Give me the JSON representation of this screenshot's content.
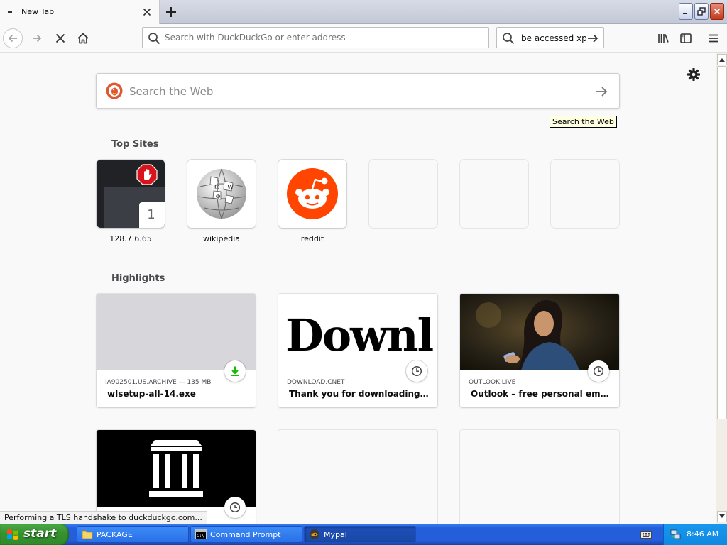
{
  "browser": {
    "tab_title": "New Tab",
    "urlbar_placeholder": "Search with DuckDuckGo or enter address",
    "searchbar_text": "be accessed xp"
  },
  "newtab": {
    "web_search_placeholder": "Search the Web",
    "tooltip": "Search the Web",
    "top_sites_title": "Top Sites",
    "top_sites": [
      {
        "label": "128.7.6.65",
        "pin_number": "1"
      },
      {
        "label": "wikipedia"
      },
      {
        "label": "reddit"
      }
    ],
    "highlights_title": "Highlights",
    "highlights": [
      {
        "context": "IA902501.US.ARCHIVE — 135 MB",
        "title": "wlsetup-all-14.exe"
      },
      {
        "context": "DOWNLOAD.CNET",
        "title": "Thank you for downloading Win...",
        "image_text": "Downl"
      },
      {
        "context": "OUTLOOK.LIVE",
        "title": "Outlook – free personal email an..."
      }
    ]
  },
  "status_text": "Performing a TLS handshake to duckduckgo.com...",
  "taskbar": {
    "start_label": "start",
    "items": [
      {
        "label": "PACKAGE"
      },
      {
        "label": "Command Prompt"
      },
      {
        "label": "Mypal"
      }
    ],
    "clock": "8:46 AM"
  },
  "colors": {
    "reddit_orange": "#ff4500",
    "download_green": "#12bc00",
    "xp_blue": "#245edb",
    "start_green": "#36912f"
  }
}
